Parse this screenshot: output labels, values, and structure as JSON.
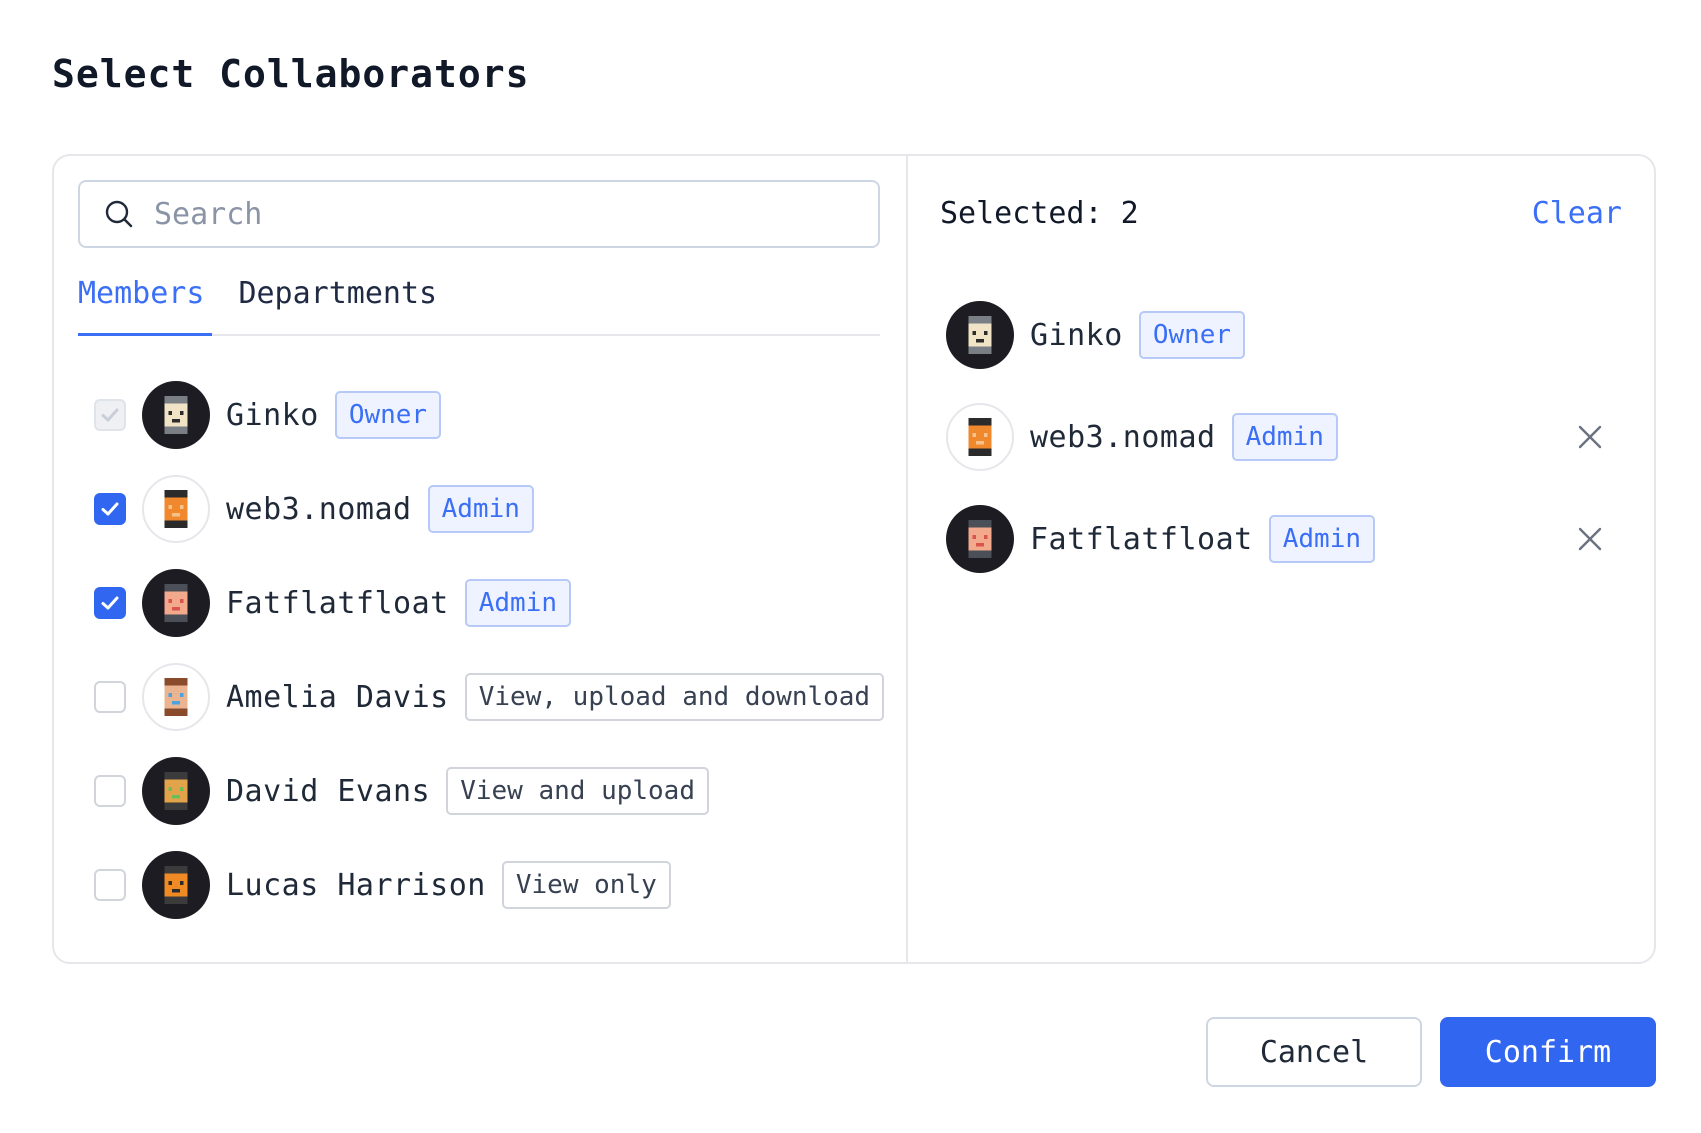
{
  "page": {
    "title": "Select Collaborators"
  },
  "search": {
    "placeholder": "Search",
    "value": ""
  },
  "tabs": [
    {
      "label": "Members",
      "active": true
    },
    {
      "label": "Departments",
      "active": false
    }
  ],
  "members": [
    {
      "name": "Ginko",
      "badge": "Owner",
      "badge_type": "role",
      "checked": true,
      "disabled": true,
      "avatar": "dark"
    },
    {
      "name": "web3.nomad",
      "badge": "Admin",
      "badge_type": "role",
      "checked": true,
      "disabled": false,
      "avatar": "light"
    },
    {
      "name": "Fatflatfloat",
      "badge": "Admin",
      "badge_type": "role",
      "checked": true,
      "disabled": false,
      "avatar": "dark"
    },
    {
      "name": "Amelia Davis",
      "badge": "View, upload and download",
      "badge_type": "perm",
      "checked": false,
      "disabled": false,
      "avatar": "light"
    },
    {
      "name": "David Evans",
      "badge": "View and upload",
      "badge_type": "perm",
      "checked": false,
      "disabled": false,
      "avatar": "dark"
    },
    {
      "name": "Lucas Harrison",
      "badge": "View only",
      "badge_type": "perm",
      "checked": false,
      "disabled": false,
      "avatar": "dark"
    }
  ],
  "selected": {
    "count_label": "Selected: 2",
    "clear_label": "Clear",
    "items": [
      {
        "name": "Ginko",
        "badge": "Owner",
        "removable": false,
        "avatar": "dark"
      },
      {
        "name": "web3.nomad",
        "badge": "Admin",
        "removable": true,
        "avatar": "light"
      },
      {
        "name": "Fatflatfloat",
        "badge": "Admin",
        "removable": true,
        "avatar": "dark"
      }
    ]
  },
  "footer": {
    "cancel_label": "Cancel",
    "confirm_label": "Confirm"
  },
  "colors": {
    "accent": "#3166f1",
    "link": "#3b6ff5",
    "border": "#e5e7eb"
  },
  "icons": {
    "search": "search-icon",
    "check": "check-icon",
    "remove": "close-icon"
  }
}
